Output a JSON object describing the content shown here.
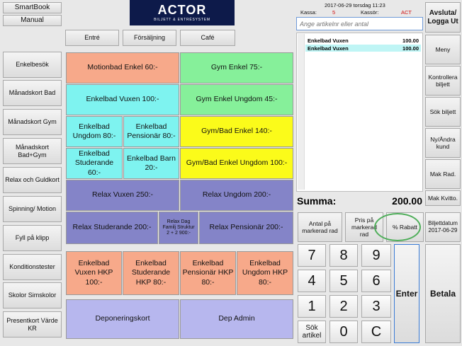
{
  "left_top": {
    "smartbook_label": "SmartBook",
    "manual_label": "Manual"
  },
  "logo": {
    "title": "ACTOR",
    "subtitle": "BILJETT & ENTRÉSYSTEM"
  },
  "category_tabs": [
    "Entré",
    "Försäljning",
    "Café"
  ],
  "sidebar": [
    "Enkelbesök",
    "Månadskort Bad",
    "Månadskort Gym",
    "Månadskort Bad+Gym",
    "Relax och Guldkort",
    "Spinning/ Motion",
    "Fyll på klipp",
    "Konditionstester",
    "Skolor Simskolor",
    "Presentkort Värde KR"
  ],
  "products": [
    {
      "label": "Motionbad Enkel 60:-",
      "color": "#f7a98a"
    },
    {
      "label": "Gym Enkel 75:-",
      "color": "#86f09a"
    },
    {
      "label": "Enkelbad Vuxen 100:-",
      "color": "#7ef3f0"
    },
    {
      "label": "Gym Enkel Ungdom 45:-",
      "color": "#86f09a"
    },
    {
      "label": "Enkelbad Ungdom 80:-",
      "color": "#7ef3f0"
    },
    {
      "label": "Enkelbad Pensionär 80:-",
      "color": "#7ef3f0"
    },
    {
      "label": "Gym/Bad Enkel 140:-",
      "color": "#fbfb1a"
    },
    {
      "label": "Enkelbad Studerande 60:-",
      "color": "#7ef3f0"
    },
    {
      "label": "Enkelbad Barn 20:-",
      "color": "#7ef3f0"
    },
    {
      "label": "Gym/Bad Enkel Ungdom 100:-",
      "color": "#fbfb1a"
    },
    {
      "label": "Relax Vuxen 250:-",
      "color": "#8484c8"
    },
    {
      "label": "Relax Ungdom 200:-",
      "color": "#8484c8"
    },
    {
      "label": "Relax Studerande 200:-",
      "color": "#8484c8"
    },
    {
      "label": "Relax Dag Familj Struktur 2 + 2 900:-",
      "color": "#8484c8"
    },
    {
      "label": "Relax Pensionär 200:-",
      "color": "#8484c8"
    },
    {
      "label": "Enkelbad Vuxen HKP 100:-",
      "color": "#f7a98a"
    },
    {
      "label": "Enkelbad Studerande HKP 80:-",
      "color": "#f7a98a"
    },
    {
      "label": "Enkelbad Pensionär HKP 80:-",
      "color": "#f7a98a"
    },
    {
      "label": "Enkelbad Ungdom HKP 80:-",
      "color": "#f7a98a"
    },
    {
      "label": "Deponeringskort",
      "color": "#b7b7ee"
    },
    {
      "label": "Dep Admin",
      "color": "#b7b7ee"
    }
  ],
  "header": {
    "datetime": "2017-06-29 torsdag 11:23",
    "kassa_label": "Kassa:",
    "kassa_value": "5",
    "kassor_label": "Kassör:",
    "kassor_value": "ACT"
  },
  "search": {
    "placeholder": "Ange artikelnr eller antal"
  },
  "cart": [
    {
      "name": "Enkelbad Vuxen",
      "price": "100.00",
      "selected": false
    },
    {
      "name": "Enkelbad Vuxen",
      "price": "100.00",
      "selected": true
    }
  ],
  "summary": {
    "label": "Summa:",
    "value": "200.00"
  },
  "actions": {
    "antal": "Antal på markerad rad",
    "pris": "Pris på markerad rad",
    "rabatt": "% Rabatt",
    "biljettdatum": "Biljettdatum 2017-06-29"
  },
  "numpad": [
    "7",
    "8",
    "9",
    "4",
    "5",
    "6",
    "1",
    "2",
    "3",
    "Sök artikel",
    "0",
    "C"
  ],
  "enter_label": "Enter",
  "betala_label": "Betala",
  "right_menu": [
    "Avsluta/ Logga Ut",
    "Meny",
    "Kontrollera biljett",
    "Sök biljett",
    "Ny/Ändra kund",
    "Mak Rad.",
    "Mak Kvitto."
  ],
  "colors": {
    "highlight_ring": "#4fae5a",
    "selected_row": "#bff5f5",
    "logo_bg": "#0d1a4a"
  }
}
